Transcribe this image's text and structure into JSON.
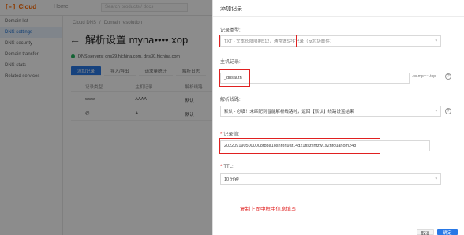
{
  "topbar": {
    "logo_mark": "[-]",
    "logo_text": "Cloud",
    "home_label": "Home",
    "search_placeholder": "Search products / docs"
  },
  "leftnav": {
    "items": [
      {
        "label": "Domain list",
        "active": false
      },
      {
        "label": "DNS settings",
        "active": true
      },
      {
        "label": "DNS security",
        "active": false
      },
      {
        "label": "Domain transfer",
        "active": false
      },
      {
        "label": "DNS stats",
        "active": false
      },
      {
        "label": "Related services",
        "active": false
      }
    ]
  },
  "main": {
    "breadcrumb": [
      "Cloud DNS",
      "/",
      "Domain resolution"
    ],
    "title": "解析设置 myna••••.xop",
    "notice": "DNS servers: dns29.hichina.com, dns30.hichina.com",
    "tabs": [
      {
        "label": "添加记录",
        "primary": true
      },
      {
        "label": "导入/导出",
        "primary": false
      },
      {
        "label": "请求量统计",
        "primary": false
      },
      {
        "label": "解析日志",
        "primary": false
      }
    ],
    "table": {
      "headers": [
        "记录类型",
        "主机记录",
        "解析线路"
      ],
      "rows": [
        [
          "www",
          "AAAA",
          "默认"
        ],
        [
          "@",
          "A",
          "默认"
        ]
      ]
    }
  },
  "drawer": {
    "title": "添加记录",
    "record_type": {
      "label": "记录类型:",
      "value": "TXT - 文本长度限制512，通常做SPF记录（反垃圾邮件）"
    },
    "host": {
      "label": "主机记录:",
      "value": "_dnsauth",
      "suffix": ".xc.mp••••.top"
    },
    "line": {
      "label": "解析线路:",
      "value": "默认 - 必填！未匹配到智能解析线路时，返回【默认】线路设置结果"
    },
    "record_value": {
      "label": "记录值:",
      "value": "2022091905000008tbpa1oshr8n9af14d21fiszfihfzw1s2nfouanom248"
    },
    "ttl": {
      "label": "TTL:",
      "value": "10 分钟"
    },
    "annotation": "复制上面中框中信息填写",
    "buttons": {
      "cancel": "取消",
      "ok": "确定"
    }
  },
  "colors": {
    "accent": "#2878e6",
    "brand": "#ff6a00",
    "highlight": "#e02020"
  }
}
